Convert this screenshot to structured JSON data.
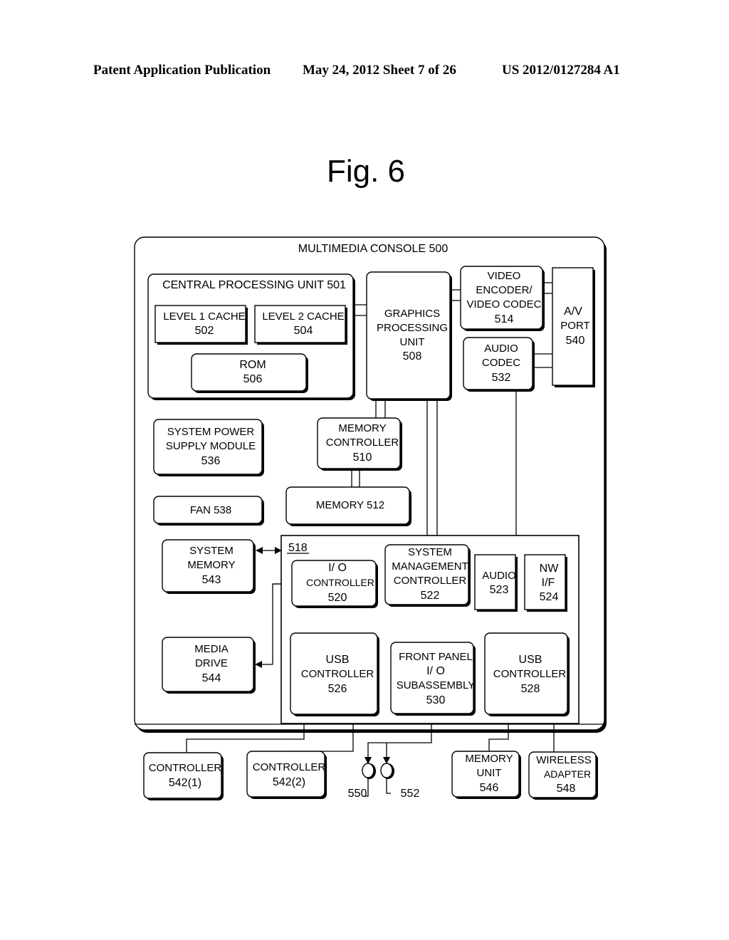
{
  "header": {
    "publication": "Patent Application Publication",
    "date_sheet": "May 24, 2012   Sheet 7 of 26",
    "patent_number": "US 2012/0127284 A1"
  },
  "figure_title": "Fig. 6",
  "diagram": {
    "console": {
      "title": "MULTIMEDIA CONSOLE 500"
    },
    "cpu": {
      "title": "CENTRAL PROCESSING UNIT 501"
    },
    "l1_cache": {
      "line1": "LEVEL 1 CACHE",
      "line2": "502"
    },
    "l2_cache": {
      "line1": "LEVEL 2 CACHE",
      "line2": "504"
    },
    "rom": {
      "line1": "ROM",
      "line2": "506"
    },
    "gpu": {
      "line1": "GRAPHICS",
      "line2": "PROCESSING",
      "line3": "UNIT",
      "line4": "508"
    },
    "video_encoder": {
      "line1": "VIDEO",
      "line2": "ENCODER/",
      "line3": "VIDEO CODEC",
      "line4": "514"
    },
    "av_port": {
      "line1": "A/V",
      "line2": "PORT",
      "line3": "540"
    },
    "audio_codec": {
      "line1": "AUDIO",
      "line2": "CODEC",
      "line3": "532"
    },
    "power_supply": {
      "line1": "SYSTEM POWER",
      "line2": "SUPPLY MODULE",
      "line3": "536"
    },
    "memory_controller": {
      "line1": "MEMORY",
      "line2": "CONTROLLER",
      "line3": "510"
    },
    "fan": {
      "label": "FAN 538"
    },
    "memory": {
      "label": "MEMORY 512"
    },
    "io_block": {
      "label": "518"
    },
    "system_memory": {
      "line1": "SYSTEM",
      "line2": "MEMORY",
      "line3": "543"
    },
    "io_controller": {
      "line1": "I/ O",
      "line2": "CONTROLLER",
      "line3": "520"
    },
    "sys_mgmt_controller": {
      "line1": "SYSTEM",
      "line2": "MANAGEMENT",
      "line3": "CONTROLLER",
      "line4": "522"
    },
    "audio": {
      "line1": "AUDIO",
      "line2": "523"
    },
    "nw_if": {
      "line1": "NW",
      "line2": "I/F",
      "line3": "524"
    },
    "media_drive": {
      "line1": "MEDIA",
      "line2": "DRIVE",
      "line3": "544"
    },
    "usb_controller_1": {
      "line1": "USB",
      "line2": "CONTROLLER",
      "line3": "526"
    },
    "front_panel": {
      "line1": "FRONT PANEL",
      "line2": "I/ O",
      "line3": "SUBASSEMBLY",
      "line4": "530"
    },
    "usb_controller_2": {
      "line1": "USB",
      "line2": "CONTROLLER",
      "line3": "528"
    },
    "controller_1": {
      "line1": "CONTROLLER",
      "line2": "542(1)"
    },
    "controller_2": {
      "line1": "CONTROLLER",
      "line2": "542(2)"
    },
    "port_550": {
      "label": "550"
    },
    "port_552": {
      "label": "552"
    },
    "memory_unit": {
      "line1": "MEMORY",
      "line2": "UNIT",
      "line3": "546"
    },
    "wireless_adapter": {
      "line1": "WIRELESS",
      "line2": "ADAPTER",
      "line3": "548"
    }
  }
}
